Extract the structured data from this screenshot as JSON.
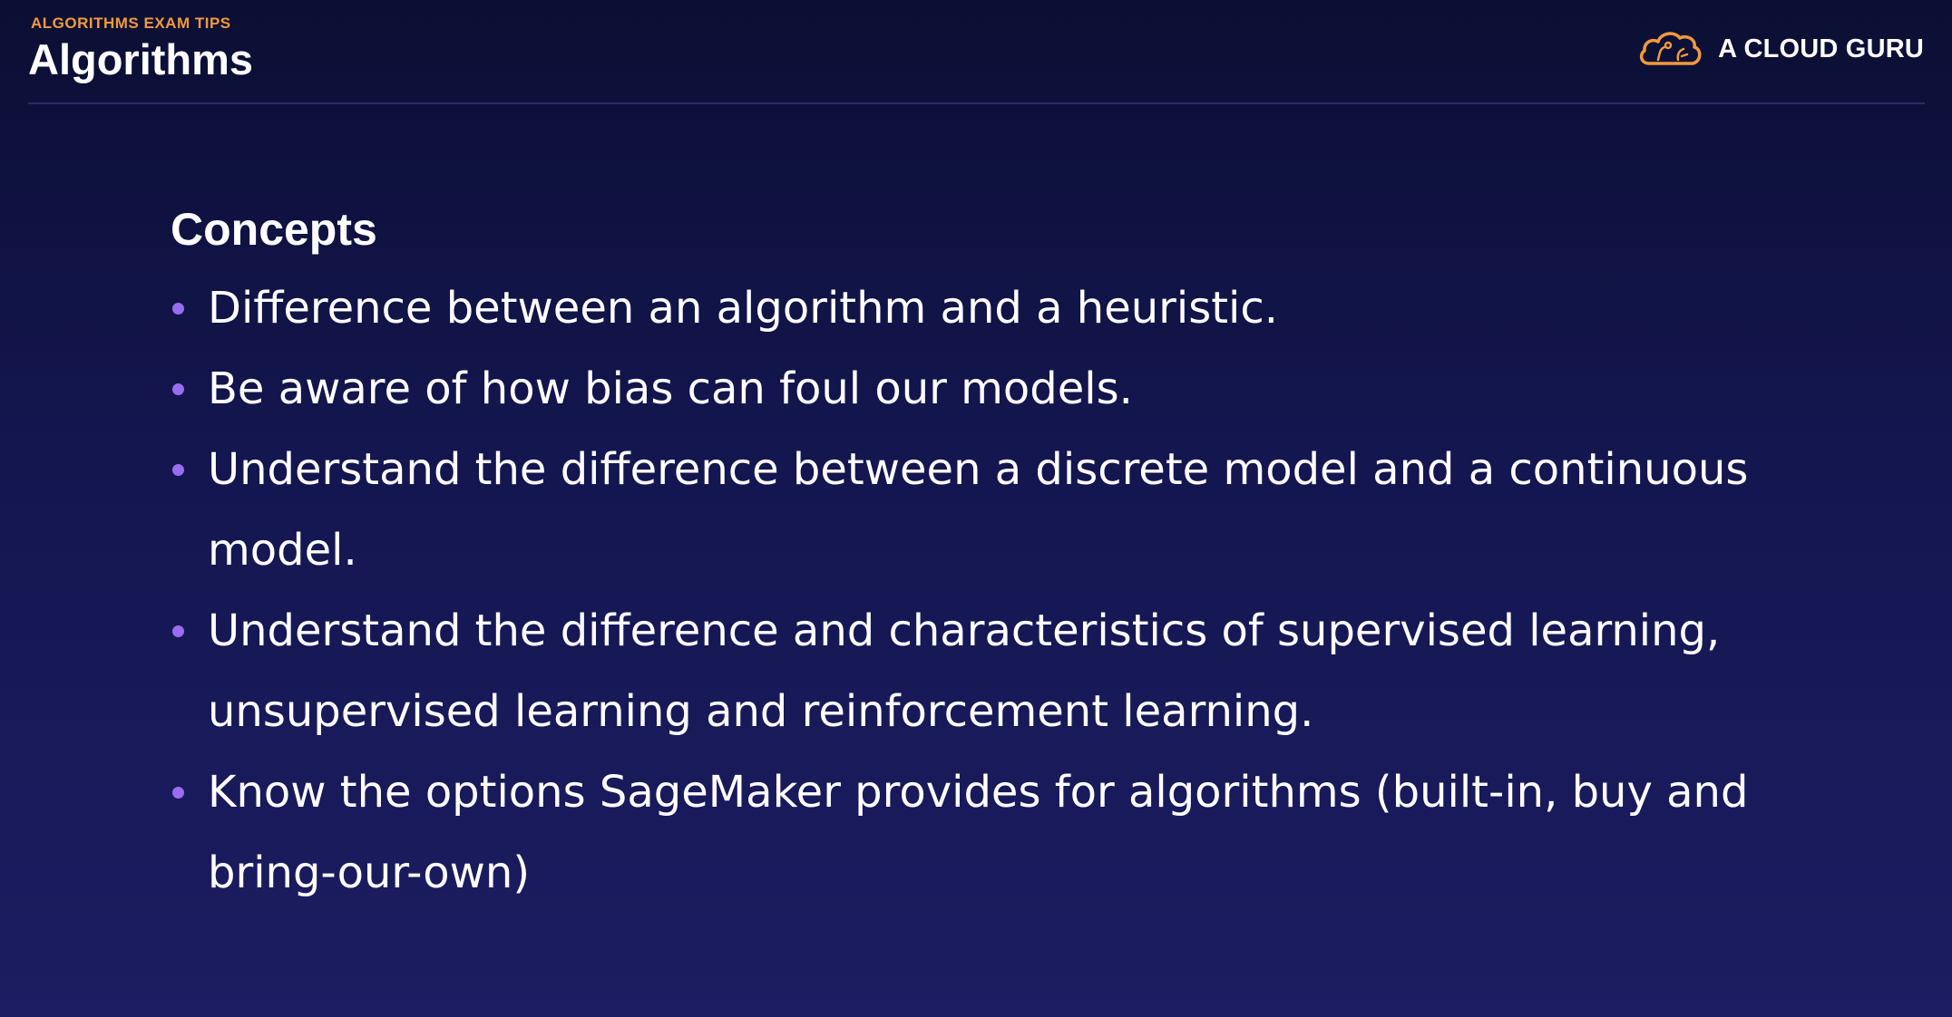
{
  "header": {
    "kicker": "ALGORITHMS EXAM TIPS",
    "title": "Algorithms",
    "logo_text": "A CLOUD GURU",
    "logo_icon": "cloud-icon"
  },
  "main": {
    "heading": "Concepts",
    "bullets": [
      {
        "text": "Difference between an algorithm and a heuristic."
      },
      {
        "text": "Be aware of how bias can foul our models."
      },
      {
        "text": "Understand the difference between a discrete model and a continuous model."
      },
      {
        "text": "Understand the difference and characteristics of supervised learning, unsupervised learning and reinforcement learning."
      },
      {
        "text": "Know the options SageMaker provides for algorithms (built-in, buy and bring-our-own)"
      }
    ]
  },
  "colors": {
    "background_top": "#0b0f33",
    "background_bottom": "#1c1d62",
    "accent_orange": "#f39a3d",
    "bullet_purple": "#9a6cf2",
    "text": "#ffffff"
  }
}
